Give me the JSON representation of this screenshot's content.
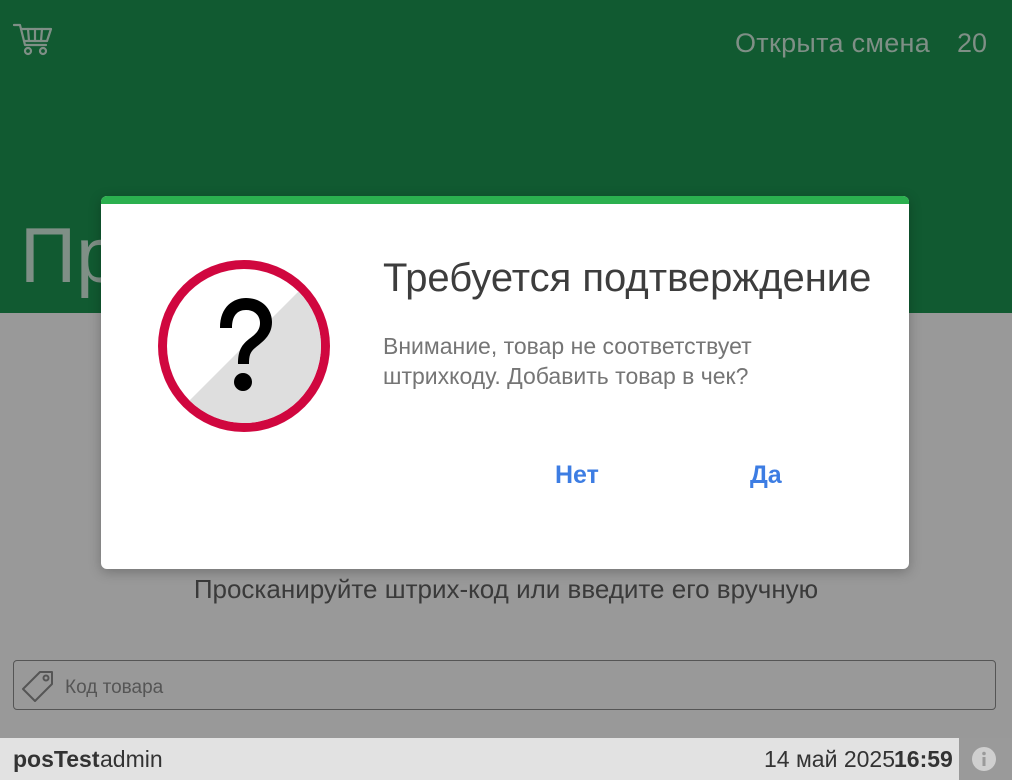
{
  "header": {
    "shift_status": "Открыта смена",
    "shift_number": "20",
    "title_partial": "Пр"
  },
  "main": {
    "scan_hint": "Просканируйте штрих-код или введите его вручную",
    "code_input": {
      "placeholder": "Код товара",
      "value": ""
    }
  },
  "footer": {
    "pos_name": "posTest",
    "user": "admin",
    "date": "14 май 2025",
    "time": "16:59"
  },
  "dialog": {
    "title": "Требуется подтверждение",
    "message": "Внимание, товар не соответствует штрихкоду. Добавить товар в чек?",
    "no_label": "Нет",
    "yes_label": "Да"
  },
  "icons": {
    "cart": "cart-icon",
    "tag": "tag-icon",
    "question": "question-warning-icon",
    "info": "info-icon"
  },
  "colors": {
    "header_bg": "#115a31",
    "dialog_accent": "#2bb04f",
    "button_text": "#3d7de3",
    "question_ring": "#d0073f"
  }
}
